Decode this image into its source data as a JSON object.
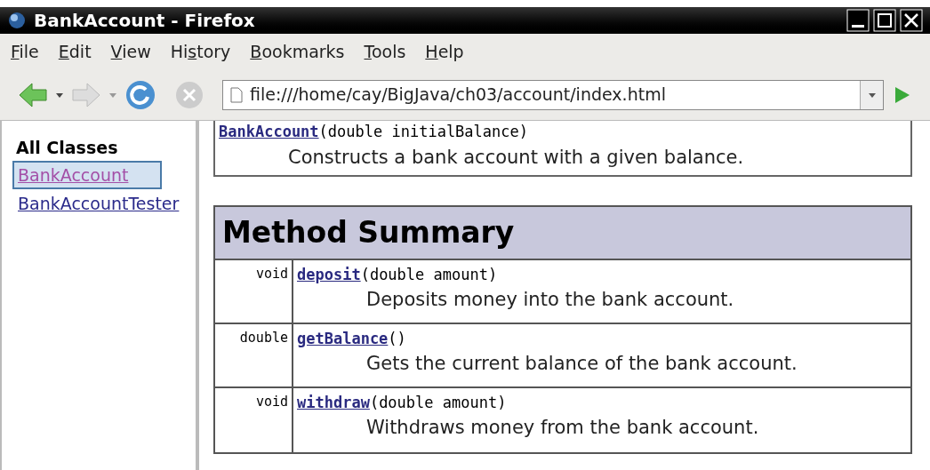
{
  "window": {
    "title": "BankAccount - Firefox"
  },
  "menu": [
    {
      "key": "F",
      "after": "ile"
    },
    {
      "key": "E",
      "after": "dit"
    },
    {
      "key": "V",
      "after": "iew"
    },
    {
      "before": "Hi",
      "key": "s",
      "after": "tory"
    },
    {
      "key": "B",
      "after": "ookmarks"
    },
    {
      "key": "T",
      "after": "ools"
    },
    {
      "key": "H",
      "after": "elp"
    }
  ],
  "address": {
    "value": "file:///home/cay/BigJava/ch03/account/index.html"
  },
  "sidebar": {
    "heading": "All Classes",
    "items": [
      {
        "label": "BankAccount",
        "selected": true
      },
      {
        "label": "BankAccountTester",
        "selected": false
      }
    ]
  },
  "constructor": {
    "name": "BankAccount",
    "params": "(double initialBalance)",
    "description": "Constructs a bank account with a given balance."
  },
  "method_summary": {
    "title": "Method Summary",
    "rows": [
      {
        "type": "void",
        "name": "deposit",
        "params": "(double amount)",
        "description": "Deposits money into the bank account."
      },
      {
        "type": "double",
        "name": "getBalance",
        "params": "()",
        "description": "Gets the current balance of the bank account."
      },
      {
        "type": "void",
        "name": "withdraw",
        "params": "(double amount)",
        "description": "Withdraws money from the bank account."
      }
    ]
  }
}
